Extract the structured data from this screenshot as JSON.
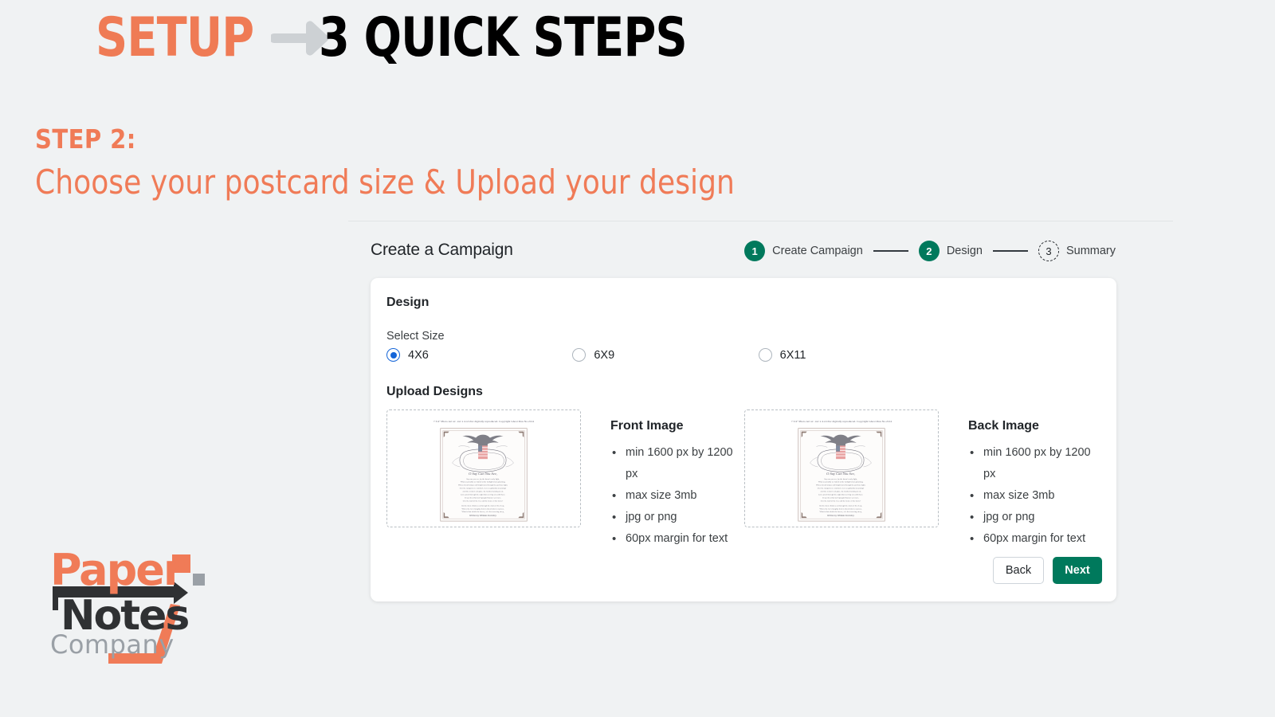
{
  "banner": {
    "setup_word": "SETUP",
    "arrow_icon": "arrow-right-icon",
    "steps_word": "3 QUICK STEPS"
  },
  "step_heading": {
    "label": "STEP 2:",
    "subtitle": "Choose your postcard size & Upload your design"
  },
  "app": {
    "title": "Create a Campaign",
    "stepper": [
      {
        "number": "1",
        "label": "Create Campaign",
        "state": "done"
      },
      {
        "number": "2",
        "label": "Design",
        "state": "done"
      },
      {
        "number": "3",
        "label": "Summary",
        "state": "pending"
      }
    ]
  },
  "card": {
    "title": "Design",
    "select_size_label": "Select Size",
    "size_options": [
      {
        "label": "4X6",
        "selected": true
      },
      {
        "label": "6X9",
        "selected": false
      },
      {
        "label": "6X11",
        "selected": false
      }
    ],
    "upload_designs_label": "Upload Designs",
    "uploads": [
      {
        "dropzone_name": "front-image-dropzone",
        "title": "Front Image",
        "specs": [
          "min 1600 px by 1200 px",
          "max size 3mb",
          "jpg or png",
          "60px margin for text"
        ]
      },
      {
        "dropzone_name": "back-image-dropzone",
        "title": "Back Image",
        "specs": [
          "min 1600 px by 1200 px",
          "max size 3mb",
          "jpg or png",
          "60px margin for text"
        ]
      }
    ],
    "back_label": "Back",
    "next_label": "Next"
  },
  "logo": {
    "word_one": "Paper",
    "word_two": "Notes",
    "word_three": "Company"
  },
  "colors": {
    "brand_orange": "#f07b57",
    "brand_green": "#00795c",
    "radio_blue": "#1565d8",
    "page_background": "#f0f2f3",
    "logo_dark": "#2b2b2b",
    "logo_gray": "#9aa0a6"
  }
}
